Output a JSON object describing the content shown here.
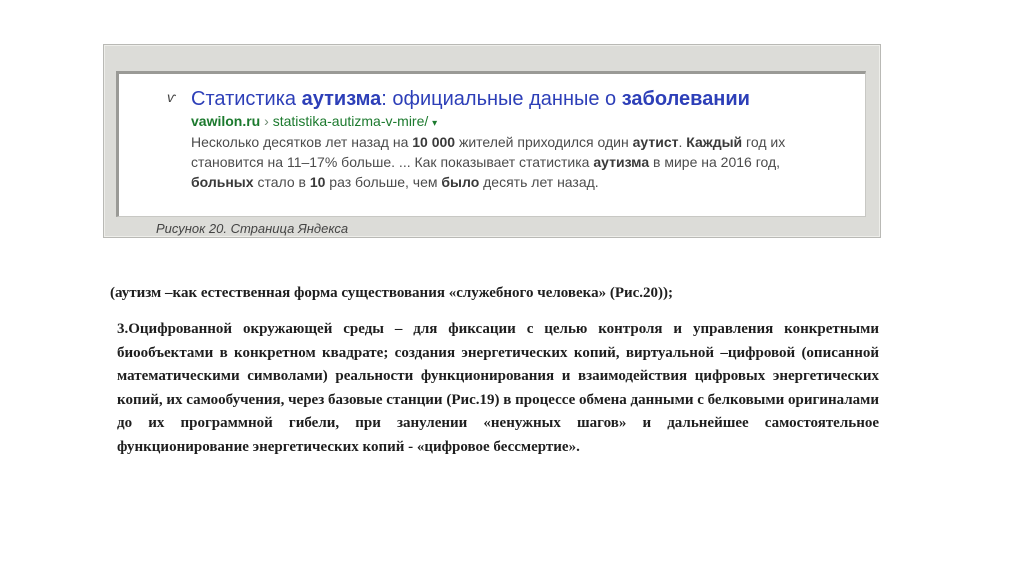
{
  "figure": {
    "result": {
      "title_parts": [
        {
          "text": "Статистика ",
          "bold": false
        },
        {
          "text": "аутизма",
          "bold": true
        },
        {
          "text": ": официальные данные о ",
          "bold": false
        },
        {
          "text": "заболевании",
          "bold": true
        }
      ],
      "url_domain": "vawilon.ru",
      "url_sep": " › ",
      "url_path": "statistika-autizma-v-mire/",
      "url_caret": "▾",
      "snippet_parts": [
        {
          "text": "Несколько десятков лет назад на ",
          "bold": false
        },
        {
          "text": "10 000",
          "bold": true
        },
        {
          "text": " жителей приходился один ",
          "bold": false
        },
        {
          "text": "аутист",
          "bold": true
        },
        {
          "text": ". ",
          "bold": false
        },
        {
          "text": "Каждый",
          "bold": true
        },
        {
          "text": " год их становится на 11–17% больше. ... Как показывает статистика ",
          "bold": false
        },
        {
          "text": "аутизма",
          "bold": true
        },
        {
          "text": " в мире на 2016 год, ",
          "bold": false
        },
        {
          "text": "больных",
          "bold": true
        },
        {
          "text": " стало в ",
          "bold": false
        },
        {
          "text": "10",
          "bold": true
        },
        {
          "text": " раз больше, чем ",
          "bold": false
        },
        {
          "text": "было",
          "bold": true
        },
        {
          "text": " десять лет назад.",
          "bold": false
        }
      ]
    },
    "caption": "Рисунок 20. Страница Яндекса"
  },
  "text": {
    "line1": "(аутизм –как естественная форма существования «служебного человека» (Рис.20));",
    "paragraph": "3.Оцифрованной окружающей среды – для фиксации с целью контроля и управления конкретными биообъектами в конкретном квадрате; создания энергетических копий, виртуальной –цифровой (описанной математическими символами) реальности функционирования и взаимодействия цифровых энергетических копий, их самообучения, через базовые станции (Рис.19) в процессе обмена данными с белковыми оригиналами до их программной гибели, при занулении «ненужных шагов» и дальнейшее самостоятельное функционирование энергетических копий - «цифровое бессмертие»."
  }
}
